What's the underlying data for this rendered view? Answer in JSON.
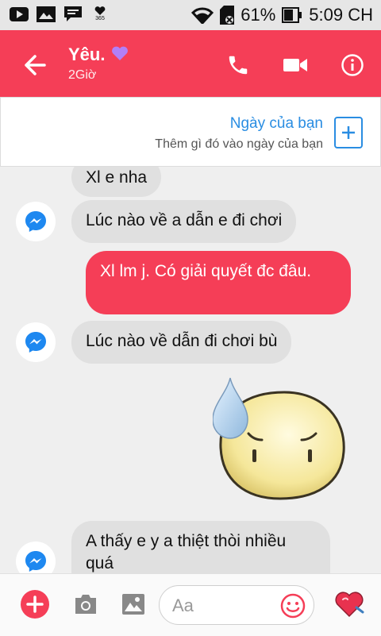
{
  "status_bar": {
    "battery_percent": "61%",
    "time": "5:09 CH",
    "icons": [
      "youtube-icon",
      "gallery-icon",
      "message-icon",
      "calendar-365-icon",
      "wifi-icon",
      "sim-icon",
      "battery-icon"
    ],
    "calendar_badge": "365"
  },
  "header": {
    "contact_name": "Yêu.",
    "status": "2Giờ",
    "background_color": "#f53e57"
  },
  "day_card": {
    "title": "Ngày của bạn",
    "subtitle": "Thêm gì đó vào ngày của bạn",
    "accent_color": "#2a8de2"
  },
  "messages": [
    {
      "from": "them",
      "text": "Xl e nha"
    },
    {
      "from": "them",
      "text": "Lúc nào về a dẫn e đi chơi"
    },
    {
      "from": "me",
      "text": "Xl lm j. Có giải quyết đc đâu."
    },
    {
      "from": "them",
      "text": "Lúc nào về dẫn đi chơi bù"
    },
    {
      "from": "me",
      "sticker": "sweat-drop-blob-sticker"
    },
    {
      "from": "them",
      "text": "A thấy e y a thiệt thòi nhiều quá"
    }
  ],
  "composer": {
    "placeholder": "Aa",
    "icons": [
      "add-icon",
      "camera-icon",
      "image-icon",
      "emoji-icon",
      "heart-icon"
    ]
  }
}
